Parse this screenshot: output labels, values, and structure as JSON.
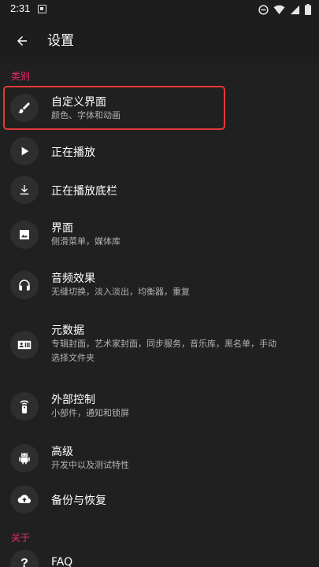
{
  "status_bar": {
    "time": "2:31",
    "notification_icon": "a-box-icon",
    "right_icons": [
      "dnd-icon",
      "wifi-icon",
      "signal-icon",
      "battery-icon"
    ]
  },
  "app_bar": {
    "back_icon": "arrow-left-icon",
    "title": "设置"
  },
  "colors": {
    "accent": "#e9276a",
    "highlight_border": "#e53935",
    "background": "#202020",
    "icon_circle": "#2e2e2e"
  },
  "sections": {
    "categories_label": "类别",
    "about_label": "关于"
  },
  "items": [
    {
      "icon": "brush-icon",
      "title": "自定义界面",
      "subtitle": "颜色、字体和动画"
    },
    {
      "icon": "play-icon",
      "title": "正在播放",
      "subtitle": ""
    },
    {
      "icon": "download-bar-icon",
      "title": "正在播放底栏",
      "subtitle": ""
    },
    {
      "icon": "image-icon",
      "title": "界面",
      "subtitle": "侧滑菜单，媒体库"
    },
    {
      "icon": "headphones-icon",
      "title": "音频效果",
      "subtitle": "无缝切换，淡入淡出，均衡器，重复"
    },
    {
      "icon": "metadata-icon",
      "title": "元数据",
      "subtitle": "专辑封面，艺术家封面，同步服务，音乐库，黑名单，手动",
      "subtitle2": "选择文件夹"
    },
    {
      "icon": "remote-icon",
      "title": "外部控制",
      "subtitle": "小部件，通知和锁屏"
    },
    {
      "icon": "android-icon",
      "title": "高级",
      "subtitle": "开发中以及测试特性"
    },
    {
      "icon": "cloud-upload-icon",
      "title": "备份与恢复",
      "subtitle": ""
    },
    {
      "icon": "help-icon",
      "title": "FAQ",
      "subtitle": ""
    }
  ]
}
